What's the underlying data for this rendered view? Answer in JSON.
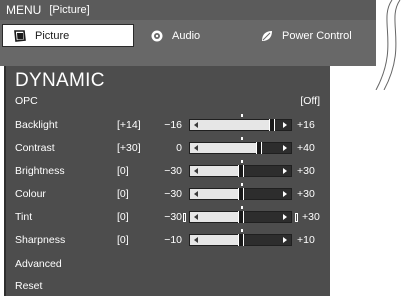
{
  "menu": {
    "title": "MENU",
    "crumb": "[Picture]"
  },
  "tabs": [
    {
      "label": "Picture",
      "icon": "picture-icon",
      "selected": true
    },
    {
      "label": "Audio",
      "icon": "audio-icon",
      "selected": false
    },
    {
      "label": "Power Control",
      "icon": "power-control-icon",
      "selected": false
    }
  ],
  "panel": {
    "title": "DYNAMIC",
    "opc": {
      "label": "OPC",
      "value": "[Off]"
    },
    "sliders": [
      {
        "label": "Backlight",
        "offset": "[+14]",
        "min": "−16",
        "max": "+16",
        "level": 0.9375,
        "end_ticks": false
      },
      {
        "label": "Contrast",
        "offset": "[+30]",
        "min": "0",
        "max": "+40",
        "level": 0.75,
        "end_ticks": false
      },
      {
        "label": "Brightness",
        "offset": "[0]",
        "min": "−30",
        "max": "+30",
        "level": 0.5,
        "end_ticks": false
      },
      {
        "label": "Colour",
        "offset": "[0]",
        "min": "−30",
        "max": "+30",
        "level": 0.5,
        "end_ticks": false
      },
      {
        "label": "Tint",
        "offset": "[0]",
        "min": "−30",
        "max": "+30",
        "level": 0.5,
        "end_ticks": true
      },
      {
        "label": "Sharpness",
        "offset": "[0]",
        "min": "−10",
        "max": "+10",
        "level": 0.5,
        "end_ticks": false
      }
    ],
    "advanced": {
      "label": "Advanced"
    },
    "reset": {
      "label": "Reset"
    }
  },
  "colors": {
    "panel": "#4d4d4d",
    "tabs": "#686868",
    "menu_bar": "#5b5b5b",
    "text": "#ffffff"
  }
}
